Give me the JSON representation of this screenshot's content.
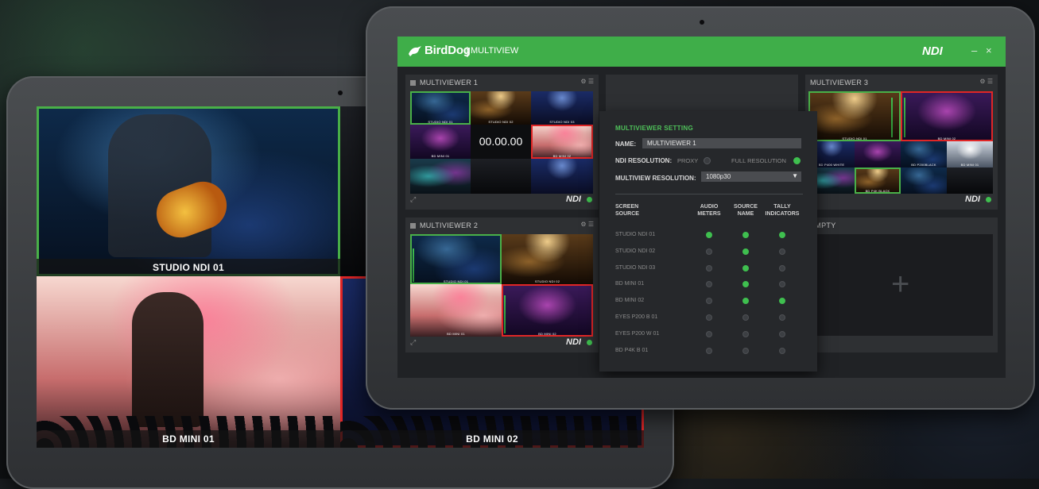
{
  "left_feeds": [
    {
      "caption": "STUDIO NDI 01",
      "border": "#49b048"
    },
    {
      "caption": "BD MINI 01",
      "border": ""
    },
    {
      "caption": "BD MINI 02",
      "border": "#e02626"
    }
  ],
  "app": {
    "brand": "BirdDog",
    "separator": "|",
    "title": "MULTIVIEW",
    "ndi_logo": "NDI",
    "minimize_glyph": "–",
    "close_glyph": "×",
    "accent": "#3fae49"
  },
  "panels": {
    "mv1": {
      "title": "MULTIVIEWER 1",
      "timer": "00.00.00",
      "ndi": "NDI",
      "tiles": [
        "STUDIO NDI 01",
        "STUDIO NDI 02",
        "STUDIO NDI 03",
        "BD MINI 01",
        "",
        "BD MINI 02",
        "",
        "",
        ""
      ]
    },
    "mv2": {
      "title": "MULTIVIEWER 2",
      "ndi": "NDI",
      "tiles": [
        "STUDIO NDI 01",
        "STUDIO NDI 02",
        "BD MINI 01",
        "BD MINI 02"
      ]
    },
    "mv3": {
      "title": "MULTIVIEWER 3",
      "ndi": "NDI",
      "tiles": [
        "STUDIO NDI 01",
        "BD MINI 02",
        "BD P400 WHITE",
        "BD P200BLACK",
        "BD MINI 01",
        "",
        "BD P4K BLACK",
        "",
        ""
      ]
    },
    "empty": {
      "title": "EMPTY",
      "plus": "+"
    }
  },
  "settings": {
    "title": "MULTIVIEWER SETTING",
    "name_label": "NAME:",
    "name_value": "MULTIVIEWER 1",
    "ndi_res_label": "NDI RESOLUTION:",
    "opt_proxy": "PROXY",
    "opt_full": "FULL RESOLUTION",
    "mv_res_label": "MULTIVIEW RESOLUTION:",
    "mv_res_value": "1080p30",
    "dropdown_glyph": "▼",
    "col_screen": [
      "SCREEN",
      "SOURCE"
    ],
    "col_audio": [
      "AUDIO",
      "METERS"
    ],
    "col_source": [
      "SOURCE",
      "NAME"
    ],
    "col_tally": [
      "TALLY",
      "INDICATORS"
    ],
    "rows": [
      {
        "name": "STUDIO NDI 01",
        "audio": true,
        "source": true,
        "tally": true
      },
      {
        "name": "STUDIO NDI 02",
        "audio": false,
        "source": true,
        "tally": false
      },
      {
        "name": "STUDIO NDI 03",
        "audio": false,
        "source": true,
        "tally": false
      },
      {
        "name": "BD MINI 01",
        "audio": false,
        "source": true,
        "tally": false
      },
      {
        "name": "BD MINI 02",
        "audio": false,
        "source": true,
        "tally": true
      },
      {
        "name": "EYES P200 B 01",
        "audio": false,
        "source": false,
        "tally": false
      },
      {
        "name": "EYES P200 W 01",
        "audio": false,
        "source": false,
        "tally": false
      },
      {
        "name": "BD P4K B 01",
        "audio": false,
        "source": false,
        "tally": false
      }
    ]
  }
}
